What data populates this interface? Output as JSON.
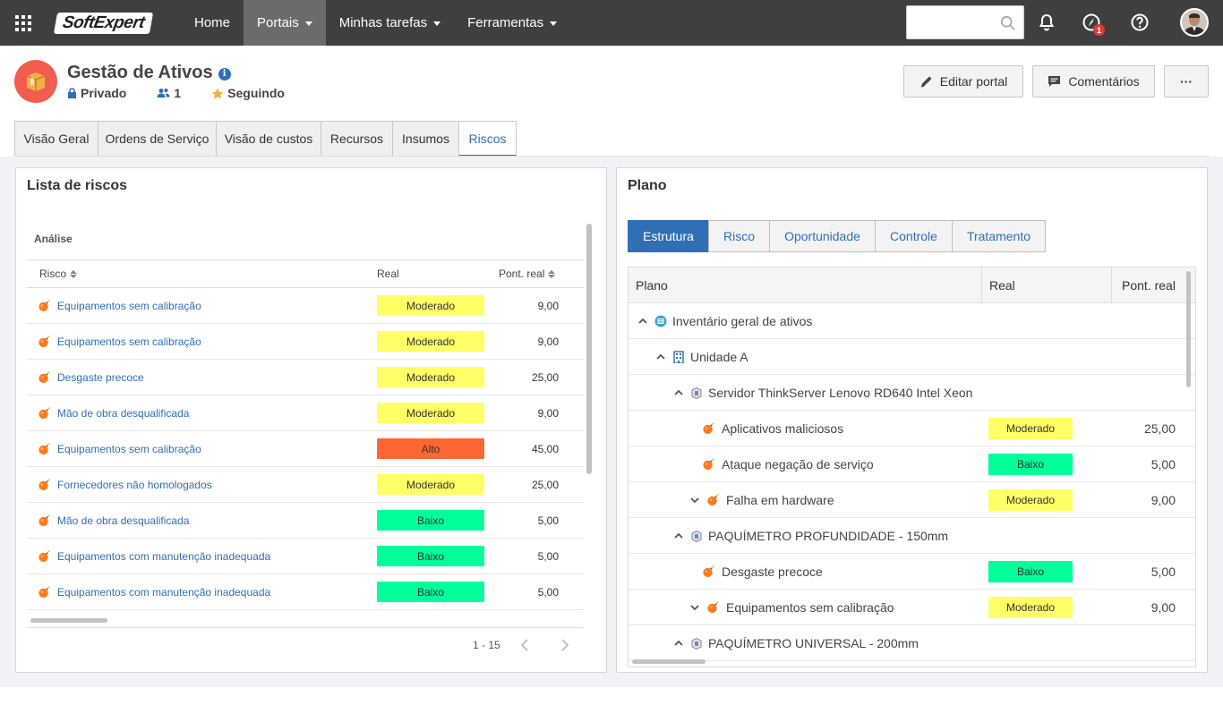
{
  "topnav": {
    "logo_text": "SoftExpert",
    "items": [
      {
        "label": "Home",
        "caret": false
      },
      {
        "label": "Portais",
        "caret": true,
        "active": true
      },
      {
        "label": "Minhas tarefas",
        "caret": true
      },
      {
        "label": "Ferramentas",
        "caret": true
      }
    ],
    "search": {
      "value": "",
      "placeholder": ""
    },
    "notification_badge": "1"
  },
  "portal": {
    "title": "Gestão de Ativos",
    "visibility": "Privado",
    "members": "1",
    "following": "Seguindo",
    "buttons": {
      "edit": "Editar portal",
      "comments": "Comentários",
      "more": "···"
    }
  },
  "tabs": [
    {
      "label": "Visão Geral"
    },
    {
      "label": "Ordens de Serviço"
    },
    {
      "label": "Visão de custos"
    },
    {
      "label": "Recursos"
    },
    {
      "label": "Insumos"
    },
    {
      "label": "Riscos",
      "active": true
    }
  ],
  "colors": {
    "Moderado": "#ffff66",
    "Alto": "#ff6633",
    "Baixo": "#00ff99",
    "accent": "#2f6fb5",
    "bomb": "#ff7a1a"
  },
  "risk_list": {
    "title": "Lista de riscos",
    "section": "Análise",
    "columns": {
      "risk": "Risco",
      "real": "Real",
      "score": "Pont. real"
    },
    "rows": [
      {
        "name": "Equipamentos sem calibração",
        "level": "Moderado",
        "score": "9,00"
      },
      {
        "name": "Equipamentos sem calibração",
        "level": "Moderado",
        "score": "9,00"
      },
      {
        "name": "Desgaste precoce",
        "level": "Moderado",
        "score": "25,00"
      },
      {
        "name": "Mão de obra desqualificada",
        "level": "Moderado",
        "score": "9,00"
      },
      {
        "name": "Equipamentos sem calibração",
        "level": "Alto",
        "score": "45,00"
      },
      {
        "name": "Fornecedores não homologados",
        "level": "Moderado",
        "score": "25,00"
      },
      {
        "name": "Mão de obra desqualificada",
        "level": "Baixo",
        "score": "5,00"
      },
      {
        "name": "Equipamentos com manutenção inadequada",
        "level": "Baixo",
        "score": "5,00"
      },
      {
        "name": "Equipamentos com manutenção inadequada",
        "level": "Baixo",
        "score": "5,00"
      }
    ],
    "pagination": "1 - 15"
  },
  "plan": {
    "title": "Plano",
    "segments": [
      {
        "label": "Estrutura",
        "active": true
      },
      {
        "label": "Risco"
      },
      {
        "label": "Oportunidade"
      },
      {
        "label": "Controle"
      },
      {
        "label": "Tratamento"
      }
    ],
    "columns": {
      "plan": "Plano",
      "real": "Real",
      "score": "Pont. real"
    },
    "rows": [
      {
        "label": "Inventário geral de ativos",
        "level_indent": 0,
        "chevron": "up",
        "icon": "inventory-icon",
        "real": "",
        "score": ""
      },
      {
        "label": "Unidade A",
        "level_indent": 1,
        "chevron": "up",
        "icon": "building-icon",
        "real": "",
        "score": ""
      },
      {
        "label": "Servidor ThinkServer Lenovo RD640 Intel Xeon",
        "level_indent": 2,
        "chevron": "up",
        "icon": "asset-icon",
        "real": "",
        "score": ""
      },
      {
        "label": "Aplicativos maliciosos",
        "level_indent": 3,
        "chevron": "none",
        "icon": "bomb-icon",
        "real": "Moderado",
        "score": "25,00"
      },
      {
        "label": "Ataque negação de serviço",
        "level_indent": 3,
        "chevron": "none",
        "icon": "bomb-icon",
        "real": "Baixo",
        "score": "5,00"
      },
      {
        "label": "Falha em hardware",
        "level_indent": 2,
        "chevron": "down",
        "icon": "bomb-icon",
        "real": "Moderado",
        "score": "9,00"
      },
      {
        "label": "PAQUÍMETRO PROFUNDIDADE - 150mm",
        "level_indent": 2,
        "chevron": "up",
        "icon": "asset-icon",
        "real": "",
        "score": ""
      },
      {
        "label": "Desgaste precoce",
        "level_indent": 3,
        "chevron": "none",
        "icon": "bomb-icon",
        "real": "Baixo",
        "score": "5,00"
      },
      {
        "label": "Equipamentos sem calibração",
        "level_indent": 2,
        "chevron": "down",
        "icon": "bomb-icon",
        "real": "Moderado",
        "score": "9,00"
      },
      {
        "label": "PAQUÍMETRO UNIVERSAL - 200mm",
        "level_indent": 2,
        "chevron": "up",
        "icon": "asset-icon",
        "real": "",
        "score": ""
      }
    ]
  }
}
